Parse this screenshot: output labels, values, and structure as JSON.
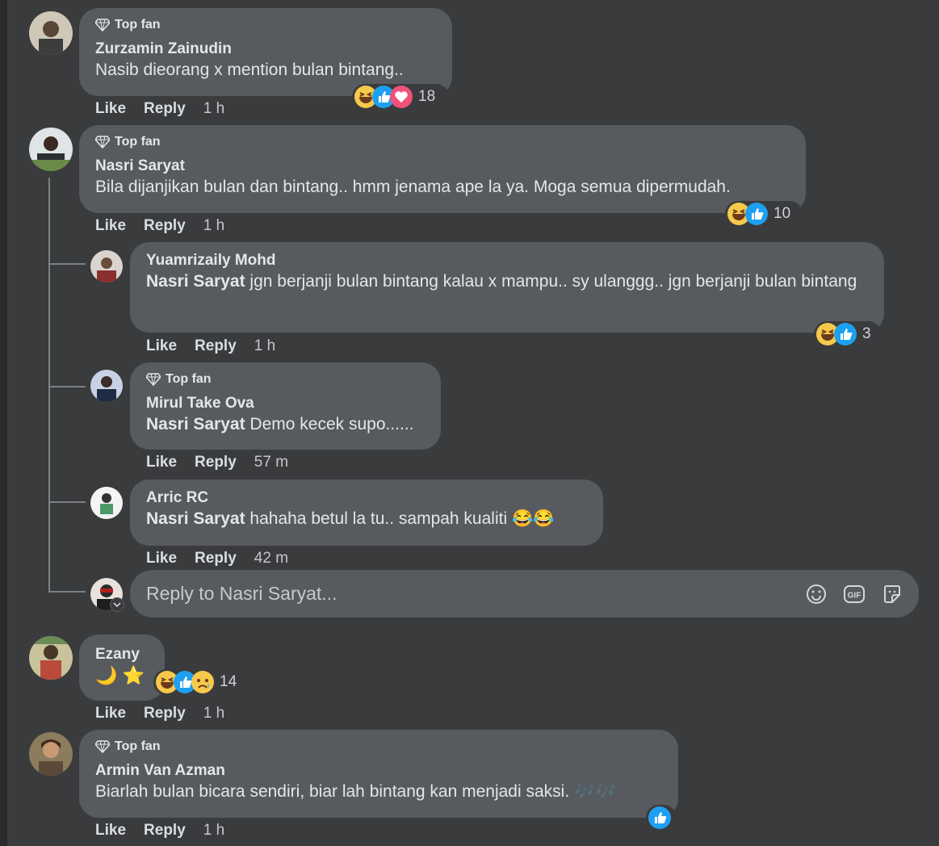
{
  "comments": [
    {
      "badge": "Top fan",
      "name": "Zurzamin Zainudin",
      "text": "Nasib dieorang x mention bulan bintang..",
      "like": "Like",
      "reply": "Reply",
      "time": "1 h",
      "reactions": "18"
    },
    {
      "badge": "Top fan",
      "name": "Nasri Saryat",
      "text": "Bila dijanjikan bulan dan bintang.. hmm jenama ape la ya. Moga semua dipermudah.",
      "like": "Like",
      "reply": "Reply",
      "time": "1 h",
      "reactions": "10"
    },
    {
      "name": "Ezany",
      "text": "🌙 ⭐",
      "like": "Like",
      "reply": "Reply",
      "time": "1 h",
      "reactions": "14"
    },
    {
      "badge": "Top fan",
      "name": "Armin Van Azman",
      "text": "Biarlah bulan bicara sendiri, biar lah bintang kan menjadi saksi. 🎶🎶",
      "like": "Like",
      "reply": "Reply",
      "time": "1 h"
    }
  ],
  "replies": [
    {
      "name": "Yuamrizaily Mohd",
      "mention": "Nasri Saryat",
      "text": " jgn berjanji bulan bintang kalau x mampu.. sy ulanggg.. jgn berjanji bulan bintang",
      "like": "Like",
      "reply": "Reply",
      "time": "1 h",
      "reactions": "3"
    },
    {
      "badge": "Top fan",
      "name": "Mirul Take Ova",
      "mention": "Nasri Saryat",
      "text": " Demo kecek supo......",
      "like": "Like",
      "reply": "Reply",
      "time": "57 m"
    },
    {
      "name": "Arric RC",
      "mention": "Nasri Saryat",
      "text": " hahaha betul la tu.. sampah kualiti 😂😂",
      "like": "Like",
      "reply": "Reply",
      "time": "42 m"
    }
  ],
  "reply_input": {
    "placeholder": "Reply to Nasri Saryat..."
  },
  "icons": {
    "badge": "diamond-icon",
    "emoji": "smiley-icon",
    "gif": "gif-icon",
    "sticker": "sticker-icon"
  },
  "colors": {
    "background": "#3a3b3c",
    "bubble": "#575a5e",
    "like": "#1ea0f2",
    "haha": "#f7c94b",
    "love": "#f0527a"
  }
}
